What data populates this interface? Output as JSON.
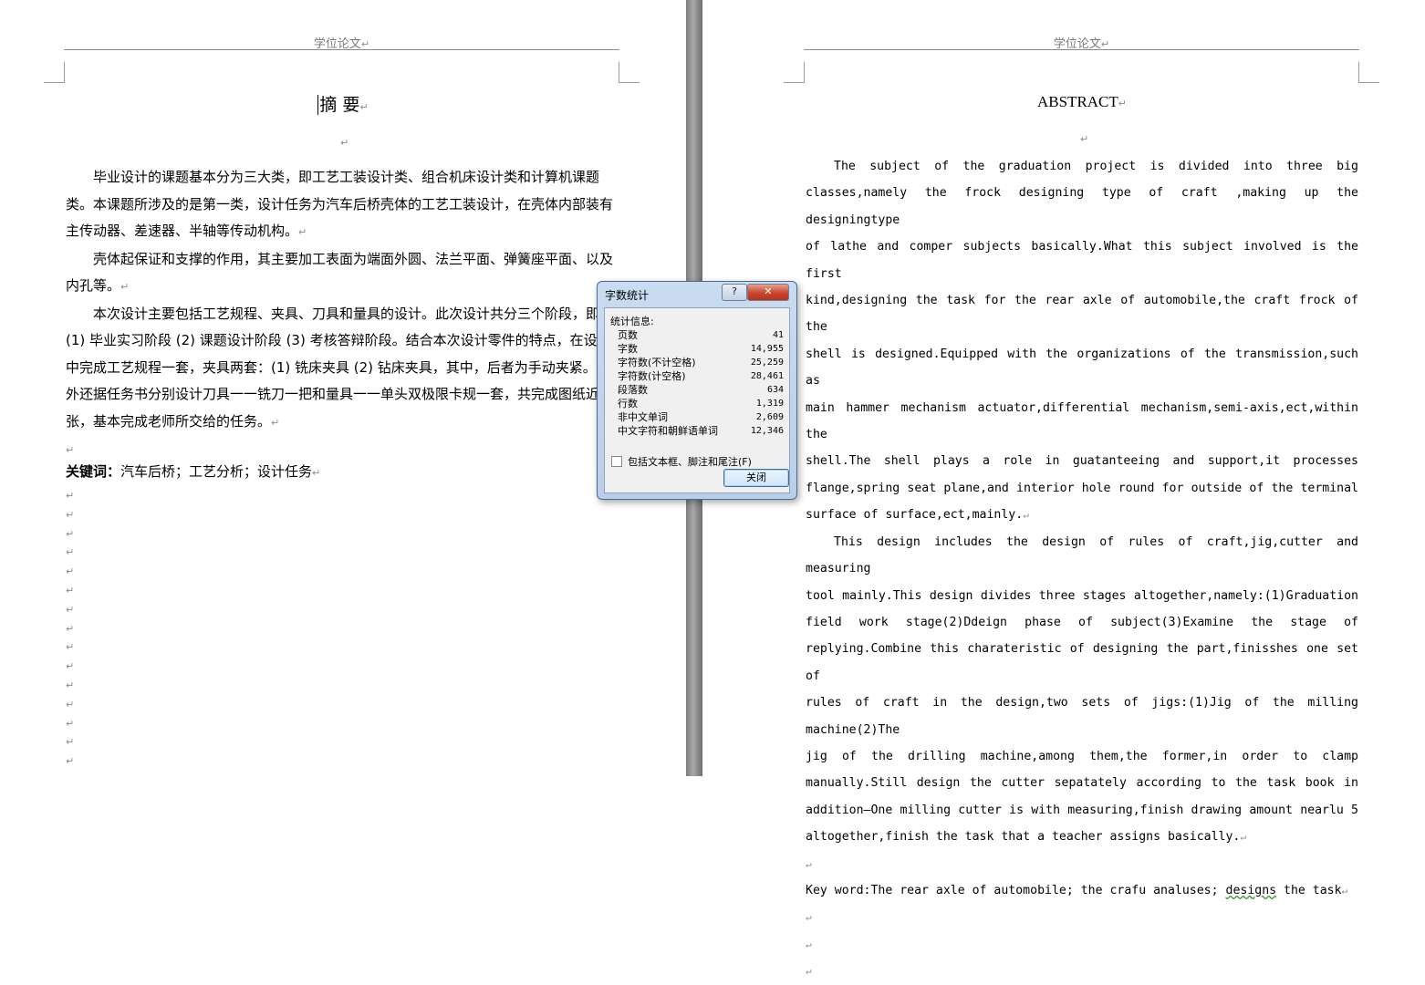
{
  "header": {
    "left": "学位论文",
    "right": "学位论文",
    "mark": "↵"
  },
  "left_page": {
    "title": "摘 要",
    "paragraphs": [
      "毕业设计的课题基本分为三大类，即工艺工装设计类、组合机床设计类和计算机课题类。本课题所涉及的是第一类，设计任务为汽车后桥壳体的工艺工装设计，在壳体内部装有主传动器、差速器、半轴等传动机构。",
      "壳体起保证和支撑的作用，其主要加工表面为端面外圆、法兰平面、弹簧座平面、以及内孔等。",
      "本次设计主要包括工艺规程、夹具、刀具和量具的设计。此次设计共分三个阶段，即：(1) 毕业实习阶段 (2) 课题设计阶段 (3) 考核答辩阶段。结合本次设计零件的特点，在设计中完成工艺规程一套，夹具两套：(1) 铣床夹具 (2) 钻床夹具，其中，后者为手动夹紧。另外还据任务书分别设计刀具一一铣刀一把和量具一一单头双极限卡规一套，共完成图纸近 5 张，基本完成老师所交给的任务。"
    ],
    "keywords_label": "关键词：",
    "keywords": "汽车后桥；工艺分析；设计任务"
  },
  "right_page": {
    "title": "ABSTRACT",
    "lines_p1": [
      "The subject of the graduation project is divided into three big",
      "classes,namely the frock designing type of craft ,making up the designingtype",
      "of lathe and comper subjects basically.What this subject involved is the first",
      "kind,designing the task for the rear axle of automobile,the craft frock of the",
      "shell is designed.Equipped with the organizations of the transmission,such as",
      "main hammer mechanism actuator,differential mechanism,semi-axis,ect,within the",
      "shell.The shell plays a role in guatanteeing and support,it processes",
      "flange,spring seat plane,and interior hole round for outside of the terminal"
    ],
    "last_p1": "surface of surface,ect,mainly.",
    "lines_p2": [
      "This design includes the design of rules of craft,jig,cutter and measuring",
      "tool mainly.This design divides three stages altogether,namely:(1)Graduation",
      "field work stage(2)Ddeign phase of subject(3)Examine the stage of",
      "replying.Combine this charateristic of designing the part,finisshes one set of",
      "rules of craft in the design,two sets of jigs:(1)Jig of the milling machine(2)The",
      "jig of the drilling machine,among them,the former,in order to clamp",
      "manually.Still design the cutter sepatately according to the task book in",
      "addition—One milling cutter is with measuring,finish drawing amount nearlu 5"
    ],
    "last_p2": "altogether,finish the task that a teacher assigns basically.",
    "keyword_prefix": "Key word:The rear axle of automobile; the crafu analuses; ",
    "keyword_wavy": "designs",
    "keyword_suffix": " the task"
  },
  "dialog": {
    "title": "字数统计",
    "help_label": "?",
    "close_x": "✕",
    "group_label": "统计信息:",
    "stats": [
      {
        "label": "页数",
        "value": "41"
      },
      {
        "label": "字数",
        "value": "14,955"
      },
      {
        "label": "字符数(不计空格)",
        "value": "25,259"
      },
      {
        "label": "字符数(计空格)",
        "value": "28,461"
      },
      {
        "label": "段落数",
        "value": "634"
      },
      {
        "label": "行数",
        "value": "1,319"
      },
      {
        "label": "非中文单词",
        "value": "2,609"
      },
      {
        "label": "中文字符和朝鲜语单词",
        "value": "12,346"
      }
    ],
    "checkbox_label": "包括文本框、脚注和尾注(F)",
    "close_button": "关闭"
  }
}
